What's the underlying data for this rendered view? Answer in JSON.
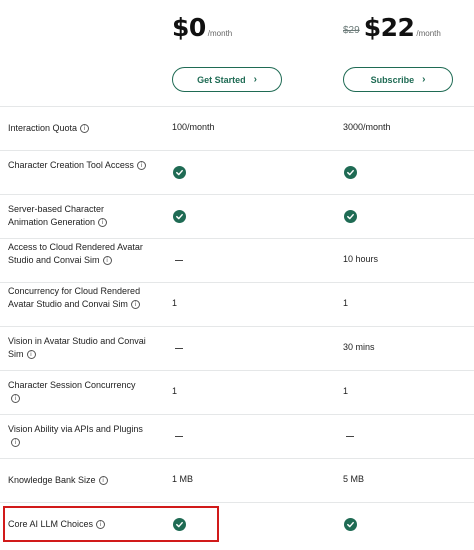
{
  "plans": [
    {
      "strike": "",
      "amount": "$0",
      "per": "/month",
      "button": "Get Started"
    },
    {
      "strike": "$29",
      "amount": "$22",
      "per": "/month",
      "button": "Subscribe"
    }
  ],
  "features": [
    {
      "label": "Interaction Quota",
      "free": "100/month",
      "paid": "3000/month"
    },
    {
      "label": "Character Creation Tool Access",
      "free": "check",
      "paid": "check"
    },
    {
      "label": "Server-based Character Animation Generation",
      "free": "check",
      "paid": "check"
    },
    {
      "label": "Access to Cloud Rendered Avatar Studio and Convai Sim",
      "free": "dash",
      "paid": "10 hours"
    },
    {
      "label": "Concurrency for Cloud Rendered Avatar Studio and Convai Sim",
      "free": "1",
      "paid": "1"
    },
    {
      "label": "Vision in Avatar Studio and Convai Sim",
      "free": "dash",
      "paid": "30 mins"
    },
    {
      "label": "Character Session Concurrency",
      "free": "1",
      "paid": "1"
    },
    {
      "label": "Vision Ability via APIs and Plugins",
      "free": "dash",
      "paid": "dash"
    },
    {
      "label": "Knowledge Bank Size",
      "free": "1 MB",
      "paid": "5 MB"
    },
    {
      "label": "Core AI LLM Choices",
      "free": "check",
      "paid": "check"
    }
  ],
  "colors": {
    "accent": "#1f6b54",
    "highlight": "#d11a1a"
  },
  "icons": {
    "info": "info-icon",
    "check": "check-circle-icon",
    "dash": "dash-icon",
    "chevron": "chevron-right-icon"
  }
}
